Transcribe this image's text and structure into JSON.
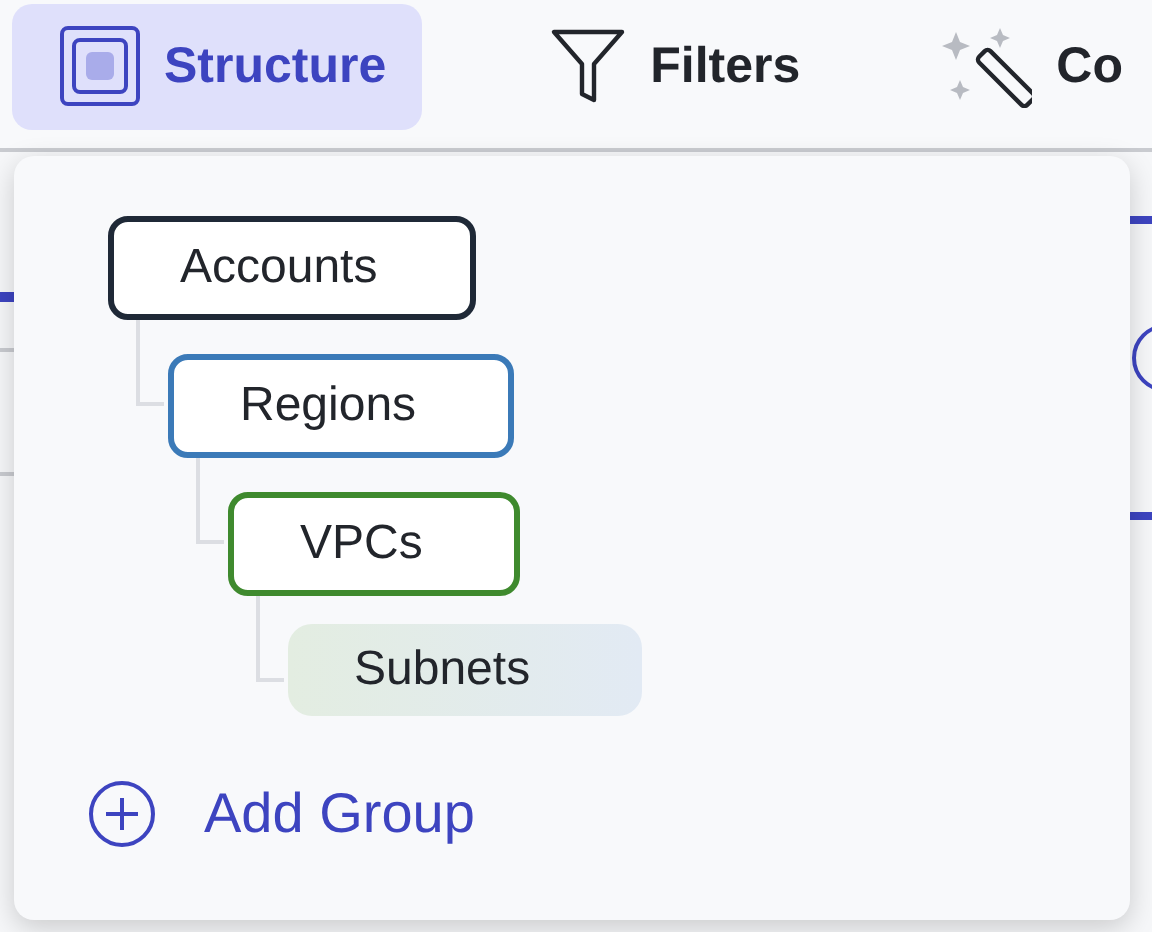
{
  "toolbar": [
    {
      "label": "Structure",
      "selected": true
    },
    {
      "label": "Filters",
      "selected": false
    },
    {
      "label": "Co",
      "selected": false
    }
  ],
  "structure_menu": {
    "groups": [
      {
        "label": "Accounts",
        "kind": "group",
        "color": "#1f2937",
        "children": [
          {
            "label": "Regions",
            "kind": "group",
            "color": "#3b7ab8",
            "children": [
              {
                "label": "VPCs",
                "kind": "group",
                "color": "#3f8a2e",
                "children": [
                  {
                    "label": "Subnets",
                    "kind": "suggested"
                  }
                ]
              }
            ]
          }
        ]
      }
    ],
    "add_button": "Add Group"
  }
}
